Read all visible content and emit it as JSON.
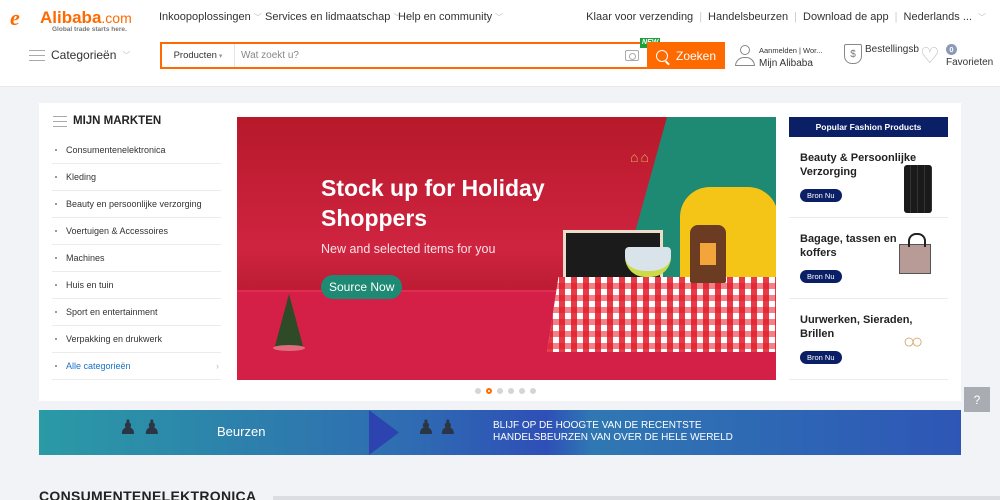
{
  "header": {
    "logo": {
      "swoosh": "e",
      "brand": "Alibaba",
      "domain": ".com",
      "tagline": "Global trade starts here."
    },
    "top_nav": [
      {
        "label": "Inkoopoplossingen"
      },
      {
        "label": "Services en lidmaatschap"
      },
      {
        "label": "Help en community"
      }
    ],
    "right_nav": [
      {
        "label": "Klaar voor verzending"
      },
      {
        "label": "Handelsbeurzen"
      },
      {
        "label": "Download de app"
      },
      {
        "label": "Nederlands ..."
      }
    ],
    "categories_label": "Categorieën",
    "search": {
      "type_label": "Producten",
      "placeholder": "Wat zoekt u?",
      "value": "",
      "new_badge": "NEW",
      "button_label": "Zoeken"
    },
    "account": {
      "signin": "Aanmelden | Wor...",
      "my_alibaba": "Mijn Alibaba"
    },
    "orders": {
      "label": "Bestellingsb",
      "icon_glyph": "$"
    },
    "favorites": {
      "count": "0",
      "label": "Favorieten"
    }
  },
  "markets": {
    "title": "MIJN MARKTEN",
    "items": [
      {
        "label": "Consumentenelektronica"
      },
      {
        "label": "Kleding"
      },
      {
        "label": "Beauty en persoonlijke verzorging"
      },
      {
        "label": "Voertuigen & Accessoires"
      },
      {
        "label": "Machines"
      },
      {
        "label": "Huis en tuin"
      },
      {
        "label": "Sport en entertainment"
      },
      {
        "label": "Verpakking en drukwerk"
      }
    ],
    "all_label": "Alle categorieën"
  },
  "banner": {
    "title_line1": "Stock up for Holiday",
    "title_line2": "Shoppers",
    "subtitle": "New and selected items for you",
    "cta": "Source Now",
    "slide_count": 6,
    "active_slide": 2
  },
  "fashion": {
    "header": "Popular Fashion Products",
    "items": [
      {
        "title": "Beauty & Persoonlijke Verzorging",
        "cta": "Bron Nu",
        "image": "hair-extensions"
      },
      {
        "title": "Bagage, tassen en koffers",
        "cta": "Bron Nu",
        "image": "handbag"
      },
      {
        "title": "Uurwerken, Sieraden, Brillen",
        "cta": "Bron Nu",
        "image": "earrings"
      }
    ]
  },
  "trade_banner": {
    "label": "Beurzen",
    "message_line1": "BLIJF OP DE HOOGTE VAN DE RECENTSTE",
    "message_line2": "HANDELSBEURZEN VAN OVER DE HELE WERELD"
  },
  "section": {
    "title": "CONSUMENTENELEKTRONICA"
  },
  "feedback": {
    "icon_glyph": "?"
  }
}
